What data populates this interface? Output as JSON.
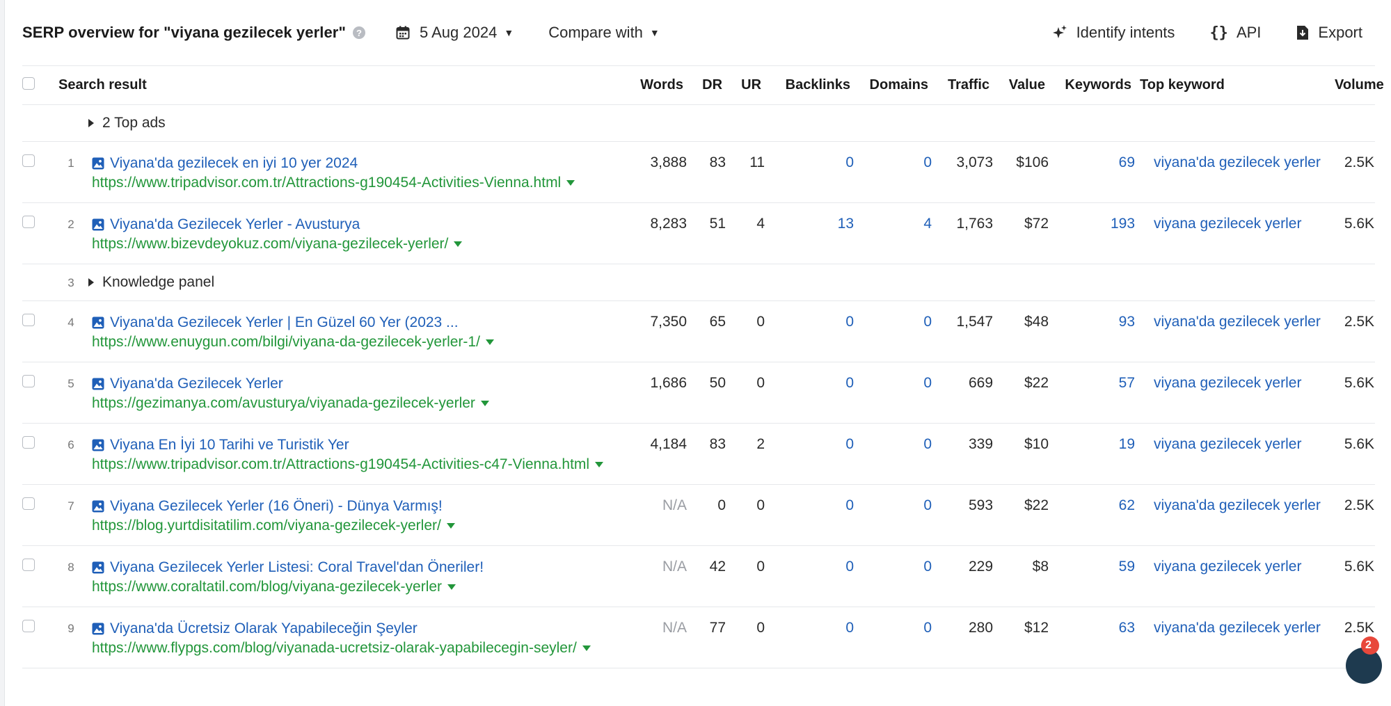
{
  "header": {
    "title": "SERP overview for \"viyana gezilecek yerler\"",
    "help_glyph": "?",
    "date": "5 Aug 2024",
    "compare": "Compare with",
    "identify": "Identify intents",
    "api": "API",
    "export": "Export"
  },
  "columns": {
    "result": "Search result",
    "words": "Words",
    "dr": "DR",
    "ur": "UR",
    "backlinks": "Backlinks",
    "domains": "Domains",
    "traffic": "Traffic",
    "value": "Value",
    "keywords": "Keywords",
    "top_keyword": "Top keyword",
    "volume": "Volume"
  },
  "ads_row": {
    "label": "2 Top ads"
  },
  "knowledge_row": {
    "pos": "3",
    "label": "Knowledge panel"
  },
  "rows": [
    {
      "pos": "1",
      "title": "Viyana'da gezilecek en iyi 10 yer 2024",
      "url": "https://www.tripadvisor.com.tr/Attractions-g190454-Activities-Vienna.html",
      "words": "3,888",
      "dr": "83",
      "ur": "11",
      "backlinks": "0",
      "domains": "0",
      "traffic": "3,073",
      "value": "$106",
      "keywords": "69",
      "top_keyword": "viyana'da gezilecek yerler",
      "volume": "2.5K"
    },
    {
      "pos": "2",
      "title": "Viyana'da Gezilecek Yerler - Avusturya",
      "url": "https://www.bizevdeyokuz.com/viyana-gezilecek-yerler/",
      "words": "8,283",
      "dr": "51",
      "ur": "4",
      "backlinks": "13",
      "domains": "4",
      "traffic": "1,763",
      "value": "$72",
      "keywords": "193",
      "top_keyword": "viyana gezilecek yerler",
      "volume": "5.6K"
    },
    {
      "pos": "4",
      "title": "Viyana'da Gezilecek Yerler | En Güzel 60 Yer (2023 ...",
      "url": "https://www.enuygun.com/bilgi/viyana-da-gezilecek-yerler-1/",
      "words": "7,350",
      "dr": "65",
      "ur": "0",
      "backlinks": "0",
      "domains": "0",
      "traffic": "1,547",
      "value": "$48",
      "keywords": "93",
      "top_keyword": "viyana'da gezilecek yerler",
      "volume": "2.5K"
    },
    {
      "pos": "5",
      "title": "Viyana'da Gezilecek Yerler",
      "url": "https://gezimanya.com/avusturya/viyanada-gezilecek-yerler",
      "words": "1,686",
      "dr": "50",
      "ur": "0",
      "backlinks": "0",
      "domains": "0",
      "traffic": "669",
      "value": "$22",
      "keywords": "57",
      "top_keyword": "viyana gezilecek yerler",
      "volume": "5.6K"
    },
    {
      "pos": "6",
      "title": "Viyana En İyi 10 Tarihi ve Turistik Yer",
      "url": "https://www.tripadvisor.com.tr/Attractions-g190454-Activities-c47-Vienna.html",
      "words": "4,184",
      "dr": "83",
      "ur": "2",
      "backlinks": "0",
      "domains": "0",
      "traffic": "339",
      "value": "$10",
      "keywords": "19",
      "top_keyword": "viyana gezilecek yerler",
      "volume": "5.6K"
    },
    {
      "pos": "7",
      "title": "Viyana Gezilecek Yerler (16 Öneri) - Dünya Varmış!",
      "url": "https://blog.yurtdisitatilim.com/viyana-gezilecek-yerler/",
      "words": "N/A",
      "dr": "0",
      "ur": "0",
      "backlinks": "0",
      "domains": "0",
      "traffic": "593",
      "value": "$22",
      "keywords": "62",
      "top_keyword": "viyana'da gezilecek yerler",
      "volume": "2.5K"
    },
    {
      "pos": "8",
      "title": "Viyana Gezilecek Yerler Listesi: Coral Travel'dan Öneriler!",
      "url": "https://www.coraltatil.com/blog/viyana-gezilecek-yerler",
      "words": "N/A",
      "dr": "42",
      "ur": "0",
      "backlinks": "0",
      "domains": "0",
      "traffic": "229",
      "value": "$8",
      "keywords": "59",
      "top_keyword": "viyana gezilecek yerler",
      "volume": "5.6K"
    },
    {
      "pos": "9",
      "title": "Viyana'da Ücretsiz Olarak Yapabileceğin Şeyler",
      "url": "https://www.flypgs.com/blog/viyanada-ucretsiz-olarak-yapabilecegin-seyler/",
      "words": "N/A",
      "dr": "77",
      "ur": "0",
      "backlinks": "0",
      "domains": "0",
      "traffic": "280",
      "value": "$12",
      "keywords": "63",
      "top_keyword": "viyana'da gezilecek yerler",
      "volume": "2.5K"
    }
  ],
  "chat_badge": "2",
  "colors": {
    "link": "#1f5fb8",
    "url": "#22963a",
    "muted": "#9a9da3"
  }
}
